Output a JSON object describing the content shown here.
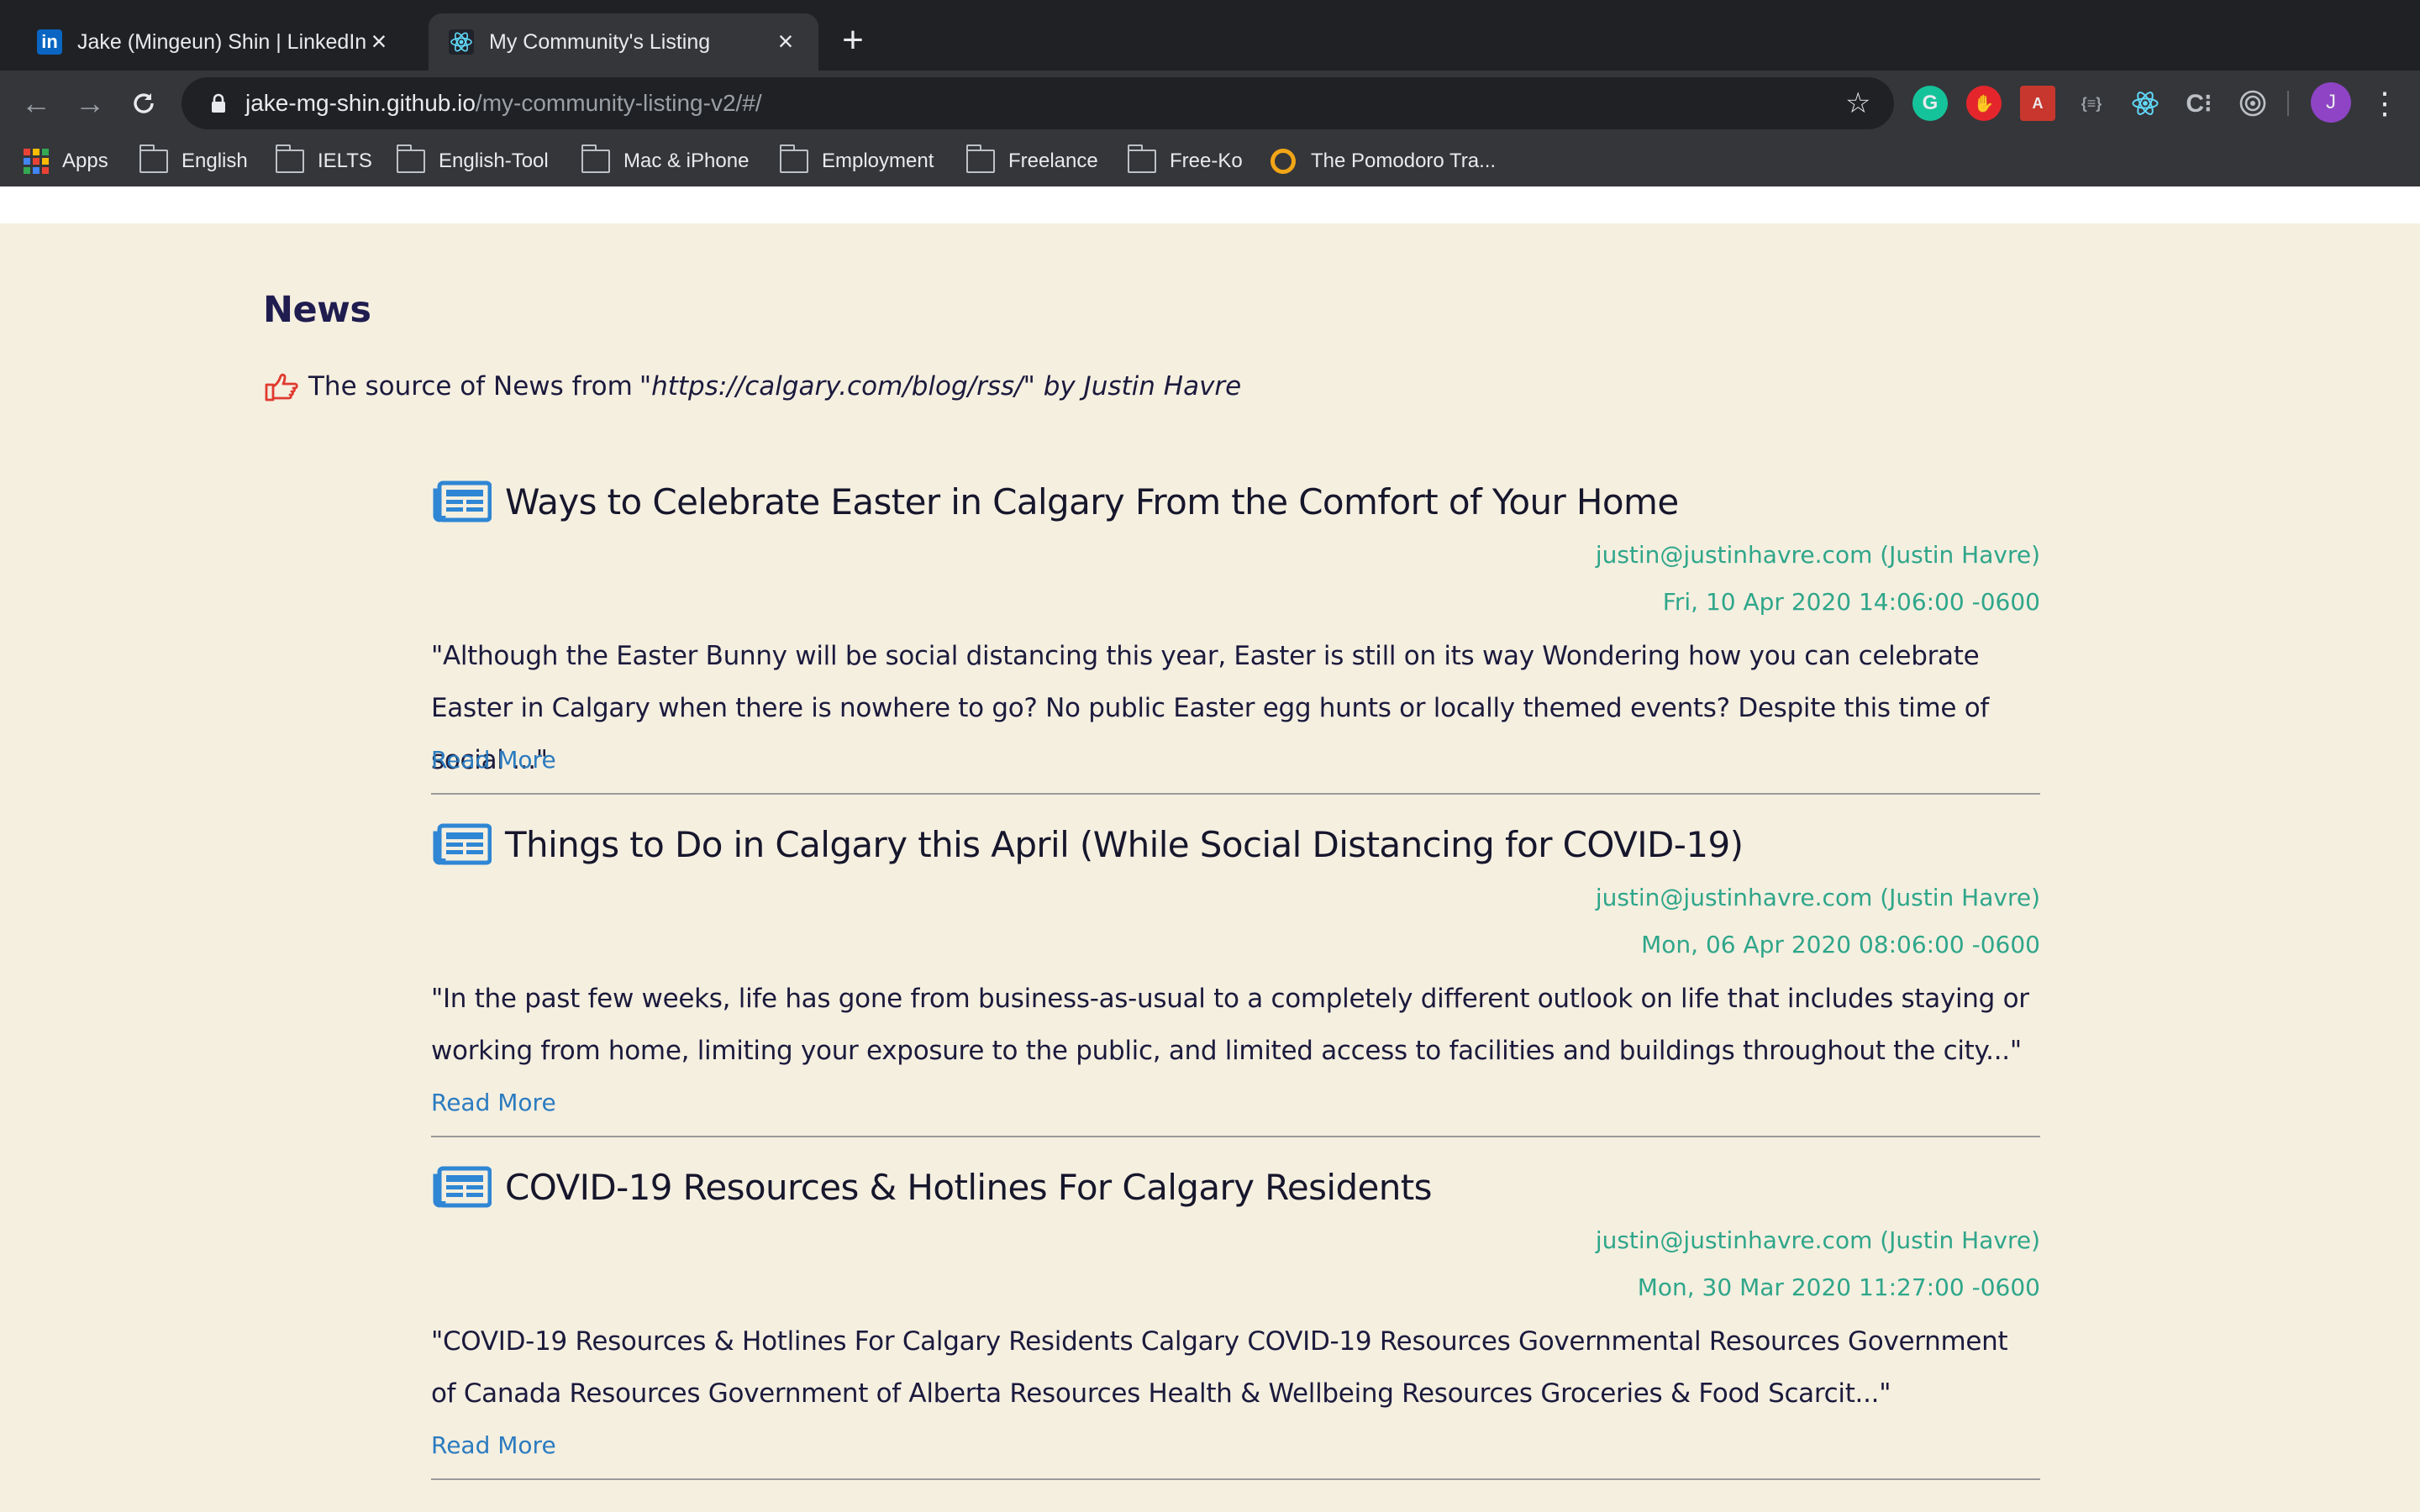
{
  "browser": {
    "tabs": [
      {
        "title": "Jake (Mingeun) Shin | LinkedIn",
        "favicon": "linkedin-icon",
        "active": false
      },
      {
        "title": "My Community's Listing",
        "favicon": "react-icon",
        "active": true
      }
    ],
    "address": {
      "host": "jake-mg-shin.github.io",
      "path": "/my-community-listing-v2/#/"
    },
    "profile_initial": "J",
    "bookmarks": [
      {
        "label": "Apps",
        "icon": "apps-grid-icon"
      },
      {
        "label": "English",
        "icon": "folder-icon"
      },
      {
        "label": "IELTS",
        "icon": "folder-icon"
      },
      {
        "label": "English-Tool",
        "icon": "folder-icon"
      },
      {
        "label": "Mac & iPhone",
        "icon": "folder-icon"
      },
      {
        "label": "Employment",
        "icon": "folder-icon"
      },
      {
        "label": "Freelance",
        "icon": "folder-icon"
      },
      {
        "label": "Free-Ko",
        "icon": "folder-icon"
      },
      {
        "label": "The Pomodoro Tra...",
        "icon": "pomodoro-icon"
      }
    ]
  },
  "colors": {
    "page_bg": "#f5efe0",
    "heading": "#1f1d4f",
    "meta_green": "#2fa68a",
    "link_blue": "#2b7bbf",
    "icon_blue": "#2e86d4",
    "hand_red": "#e03a2f"
  },
  "news": {
    "heading": "News",
    "source_prefix": "The source of News from",
    "source_italic": "\"https://calgary.com/blog/rss/\" by Justin Havre",
    "articles": [
      {
        "title": "Ways to Celebrate Easter in Calgary From the Comfort of Your Home",
        "author": "justin@justinhavre.com (Justin Havre)",
        "date": "Fri, 10 Apr 2020 14:06:00 -0600",
        "description": "\"Although the Easter Bunny will be social distancing this year, Easter is still on its way Wondering how you can celebrate Easter in Calgary when there is nowhere to go? No public Easter egg hunts or locally themed events? Despite this time of social ...\"",
        "read_more": "Read More"
      },
      {
        "title": "Things to Do in Calgary this April (While Social Distancing for COVID-19)",
        "author": "justin@justinhavre.com (Justin Havre)",
        "date": "Mon, 06 Apr 2020 08:06:00 -0600",
        "description": "\"In the past few weeks, life has gone from business-as-usual to a completely different outlook on life that includes staying or working from home, limiting your exposure to the public, and limited access to facilities and buildings throughout the city...\"",
        "read_more": "Read More"
      },
      {
        "title": "COVID-19 Resources & Hotlines For Calgary Residents",
        "author": "justin@justinhavre.com (Justin Havre)",
        "date": "Mon, 30 Mar 2020 11:27:00 -0600",
        "description": "\"COVID-19 Resources & Hotlines For Calgary Residents Calgary COVID-19 Resources Governmental Resources Government of Canada Resources Government of Alberta Resources Health & Wellbeing Resources Groceries & Food Scarcit...\"",
        "read_more": "Read More"
      }
    ]
  }
}
